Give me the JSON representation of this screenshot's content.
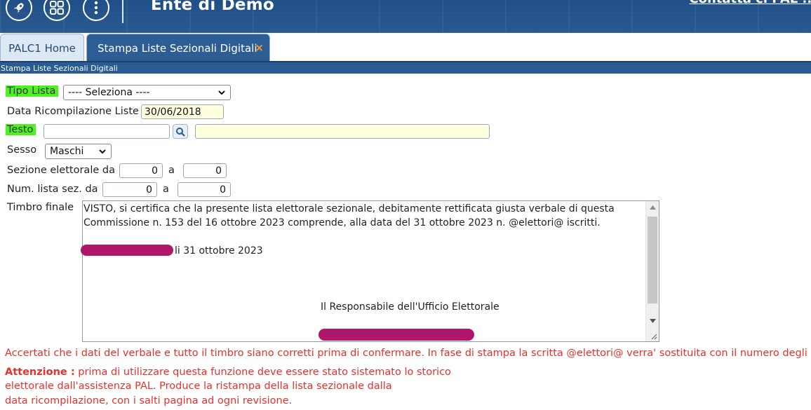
{
  "header": {
    "title": "Ente di Demo",
    "top_link": "Contatta ci PAL ..."
  },
  "tabs": [
    {
      "label": "PALC1 Home"
    },
    {
      "label": "Stampa Liste Sezionali Digitali",
      "close": "×"
    }
  ],
  "breadcrumb": "Stampa Liste Sezionali Digitali",
  "form": {
    "tipo_lista": {
      "label": "Tipo Lista",
      "selected": "---- Seleziona ----"
    },
    "data_ricompilazione": {
      "label": "Data Ricompilazione Liste",
      "value": "30/06/2018"
    },
    "testo": {
      "label": "Testo",
      "code": "",
      "description": ""
    },
    "sesso": {
      "label": "Sesso",
      "selected": "Maschi"
    },
    "sezione": {
      "label": "Sezione elettorale da",
      "from": "0",
      "to_label": "a",
      "to": "0"
    },
    "num_lista": {
      "label": "Num. lista sez. da",
      "from": "0",
      "to_label": "a",
      "to": "0"
    },
    "timbro": {
      "label": "Timbro finale",
      "line1": "VISTO,  si certifica che la presente lista elettorale sezionale, debitamente rettificata giusta verbale di questa",
      "line2": "Commissione n. 153  del 16 ottobre 2023 comprende, alla data del 31 ottobre 2023 n. @elettori@ iscritti.",
      "line3": "li 31 ottobre 2023",
      "line4": "Il Responsabile dell'Ufficio Elettorale"
    }
  },
  "notes": {
    "confirm": "Accertati che i dati del verbale e tutto il timbro siano corretti prima di confermare. In fase di stampa la scritta @elettori@ verra' sostituita con il numero degli elettori.",
    "attention_label": "Attenzione :",
    "attention_line1": " prima di utilizzare questa funzione deve essere stato sistemato lo storico",
    "attention_line2": "elettorale dall'assistenza PAL. Produce la ristampa della lista sezionale dalla",
    "attention_line3": "data ricompilazione, con i salti pagina ad ogni revisione."
  },
  "colors": {
    "header_bg": "#2a5a90",
    "highlight": "#4ff221",
    "warning_text": "#e8302c",
    "redaction": "#b0166a"
  }
}
